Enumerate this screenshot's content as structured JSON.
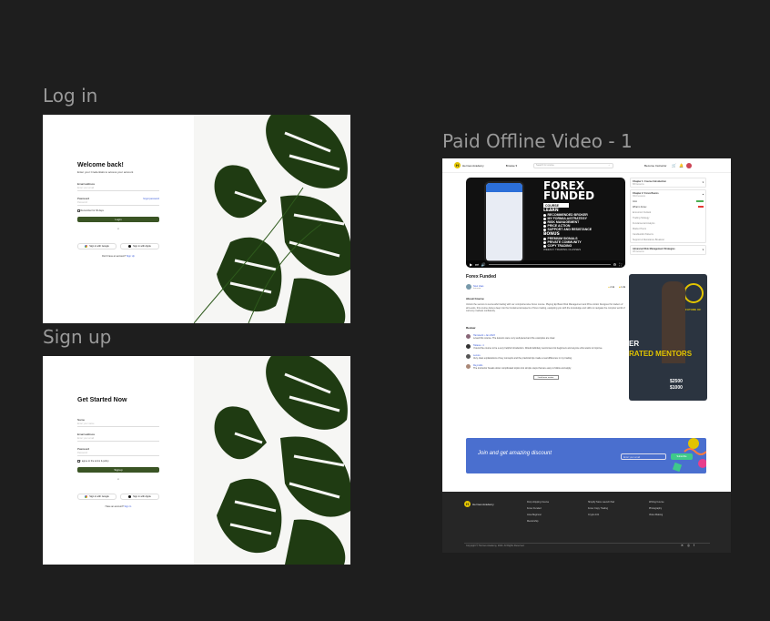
{
  "frames": {
    "login_label": "Log in",
    "signup_label": "Sign up",
    "video_label": "Paid Offline Video - 1"
  },
  "login": {
    "title": "Welcome back!",
    "subtitle": "Enter your Credentials to access your account",
    "email_label": "Email address",
    "email_placeholder": "Enter your email",
    "password_label": "Password",
    "forgot": "forgot password",
    "password_placeholder": "Password",
    "remember": "Remember for 30 days",
    "submit": "Login",
    "or": "or",
    "google": "Sign in with Google",
    "apple": "Sign in with Apple",
    "footer_text": "Don't have an account?",
    "footer_link": "Sign Up"
  },
  "signup": {
    "title": "Get Started Now",
    "name_label": "Name",
    "name_placeholder": "Enter your name",
    "email_label": "Email address",
    "email_placeholder": "Enter your email",
    "password_label": "Password",
    "password_placeholder": "Password",
    "terms": "I agree to the terms & policy",
    "submit": "Signup",
    "or": "or",
    "google": "Sign in with Google",
    "apple": "Sign in with Apple",
    "footer_text": "Have an account?",
    "footer_link": "Sign In"
  },
  "video_page": {
    "brand": "Hermes Academy",
    "nav_menu": "Browse",
    "search_placeholder": "Search for course",
    "become_instructor": "Become Instructor",
    "video": {
      "title_1": "FOREX",
      "title_2": "FUNDED",
      "tag": "COURSE",
      "learn": "LEARN",
      "points": [
        "RECOMMENDED BROKER",
        "MY FORMULA/STRATEGY",
        "RISK MANAGEMENT",
        "PRICE ACTION",
        "SUPPORT AND RESISTANCE"
      ],
      "bonus": "BONUS",
      "bonus_points": [
        "PREMIUM SIGNALS",
        "PRIVATE COMMUNITY",
        "COPY TRADING"
      ],
      "footer": "WEEKLY TRADING CLASSES"
    },
    "course_title": "Forex Funded",
    "author": "Noel Vaas",
    "author_role": "Instructor",
    "likes": "2.1k",
    "comments_count": "1.4k",
    "about_heading": "About Course",
    "about_text": "Unlock the secrets to successful trading with our comprehensive Forex course. Playing Ep Basic Risk Management and Price Action Designed for traders of all Levels, this course delves deep into the fundamental aspects of forex trading, equipping you with the knowledge and skills to navigate the complex world of currency markets confidently.",
    "reviews_heading": "Review",
    "reviews": [
      {
        "name": "Hamsterik • Jan 2023",
        "text": "Loved this course. The lessons were very well-paced and the examples are clear."
      },
      {
        "name": "Tatiana • 1",
        "text": "I found the course to be a very helpful introduction. Would definitely recommend to beginners and anyone who wants to improve."
      },
      {
        "name": "Lenore",
        "text": "Very clear explanations of key concepts and the practical tips made a real difference in my trading."
      },
      {
        "name": "Reynolds",
        "text": "The instructor breaks down complicated topics into simple steps that are easy to follow and apply."
      }
    ],
    "see_more": "Load more review",
    "chapters": [
      {
        "title": "Chapter 1: Course Introduction",
        "meta": "8/8 lessons"
      },
      {
        "title": "Chapter 2: Forex Basics",
        "meta": "3/10 lessons"
      },
      {
        "title": "Intro",
        "meta": ""
      },
      {
        "title": "What is Forex",
        "meta": ""
      },
      {
        "title": "Economic Outlook",
        "meta": ""
      },
      {
        "title": "Trading Strategy",
        "meta": ""
      },
      {
        "title": "Fundamental Analysis",
        "meta": ""
      },
      {
        "title": "Market Hours",
        "meta": ""
      },
      {
        "title": "Candlestick Patterns",
        "meta": ""
      },
      {
        "title": "Support & Resistance Breakout",
        "meta": ""
      },
      {
        "title": "Advanced Risk Management Strategies",
        "meta": "0/6 lessons"
      }
    ],
    "promo": {
      "line1": "FUTURE OF",
      "line2": "ER",
      "line3": "RATED MENTORS",
      "price1": "$2500",
      "price2": "$1000"
    },
    "discount": {
      "title": "Join and get amazing discount",
      "input_placeholder": "Enter your email",
      "button": "Subscribe"
    },
    "footer": {
      "columns": [
        [
          "Drop shipping Course",
          "Forex Funded",
          "Java Beginner",
          "Mentorship"
        ],
        [
          "Shopify Store Launch Pad",
          "Forex Copy Trading",
          "Crypto 101"
        ],
        [
          "Writing Course",
          "Photography",
          "Video Making"
        ]
      ],
      "copyright": "Copyright © Hermes Academy, 2024. All Rights Reserved"
    }
  },
  "colors": {
    "background": "#1e1e1e",
    "primary_green": "#3a5424",
    "discount_blue": "#4a6fcf",
    "footer_dark": "#262626"
  }
}
